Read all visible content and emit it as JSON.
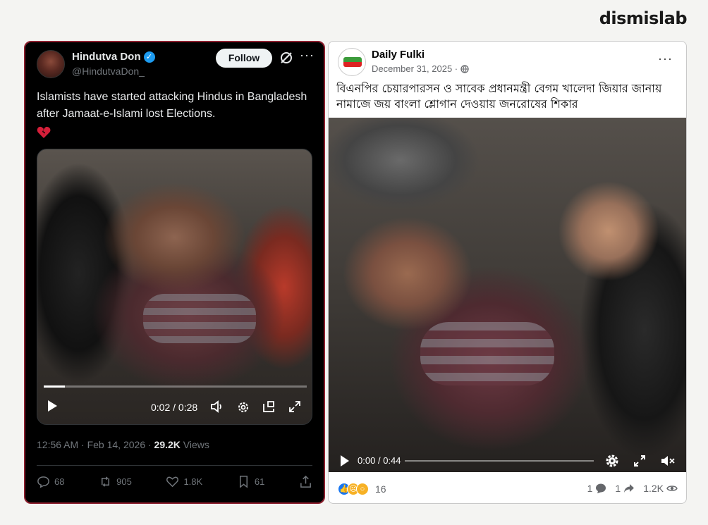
{
  "brand": {
    "name": "dismislab"
  },
  "tweet": {
    "display_name": "Hindutva Don",
    "handle": "@HindutvaDon_",
    "follow_label": "Follow",
    "text": "Islamists have started attacking Hindus in Bangladesh after Jamaat-e-Islami lost Elections.",
    "emoji_icon": "broken-heart",
    "video": {
      "current_time": "0:02",
      "separator": "/",
      "duration": "0:28",
      "progress": 0.08
    },
    "timestamp": "12:56 AM · Feb 14, 2026 ·",
    "views_count": "29.2K",
    "views_label": "Views",
    "actions": {
      "replies": "68",
      "reposts": "905",
      "likes": "1.8K",
      "bookmarks": "61"
    },
    "colors": {
      "verified": "#1d9bf0",
      "card_border": "#8b1e2d"
    }
  },
  "fb_post": {
    "page_name": "Daily Fulki",
    "date": "December 31, 2025 ·",
    "audience_icon": "globe-icon",
    "text": "বিএনপির চেয়ারপারসন ও সাবেক প্রধানমন্ত্রী বেগম খালেদা জিয়ার জানায় নামাজে জয় বাংলা শ্লোগান দেওয়ায় জনরোষের শিকার",
    "video": {
      "current_time": "0:00",
      "separator": "/",
      "duration": "0:44",
      "progress": 0
    },
    "reactions_count": "16",
    "reaction_icons": [
      "like",
      "sad",
      "wow"
    ],
    "comments_count": "1",
    "shares_count": "1",
    "views_count": "1.2K"
  }
}
